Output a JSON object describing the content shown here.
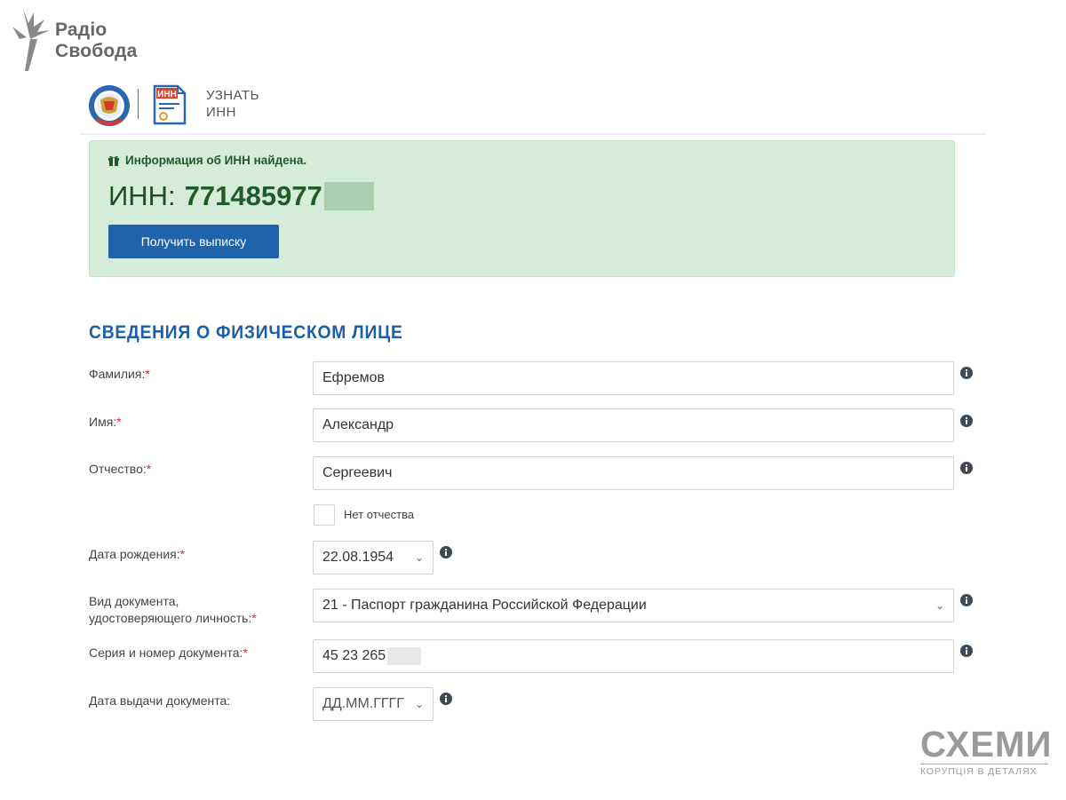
{
  "watermark": {
    "logo_text": "Радіо Свобода",
    "corner_logo_title": "СХЕМИ",
    "corner_logo_subtitle": "КОРУПЦІЯ В ДЕТАЛЯХ"
  },
  "header": {
    "title": "УЗНАТЬ ИНН",
    "emblem_icon": "fns-emblem-icon",
    "inn_icon_text": "ИНН"
  },
  "result": {
    "message": "Информация об ИНН найдена.",
    "inn_label": "ИНН:",
    "inn_value": "771485977",
    "button_label": "Получить выписку",
    "icon": "gift-icon"
  },
  "form": {
    "section_title": "СВЕДЕНИЯ О ФИЗИЧЕСКОМ ЛИЦЕ",
    "required_mark": "*",
    "fields": {
      "surname": {
        "label": "Фамилия:",
        "value": "Ефремов"
      },
      "name": {
        "label": "Имя:",
        "value": "Александр"
      },
      "patronymic": {
        "label": "Отчество:",
        "value": "Сергеевич"
      },
      "no_patronymic": {
        "label": "Нет отчества",
        "checked": false
      },
      "birth_date": {
        "label": "Дата рождения:",
        "value": "22.08.1954"
      },
      "doc_type": {
        "label_line1": "Вид документа,",
        "label_line2": "удостоверяющего личность:",
        "value": "21 - Паспорт гражданина Российской Федерации"
      },
      "doc_number": {
        "label": "Серия и номер документа:",
        "value": "45 23 265"
      },
      "doc_issue_date": {
        "label": "Дата выдачи документа:",
        "value": "ДД.ММ.ГГГГ"
      }
    }
  },
  "colors": {
    "accent": "#1f63aa",
    "success_bg": "#d4ecd9",
    "required": "#d62b2b"
  }
}
